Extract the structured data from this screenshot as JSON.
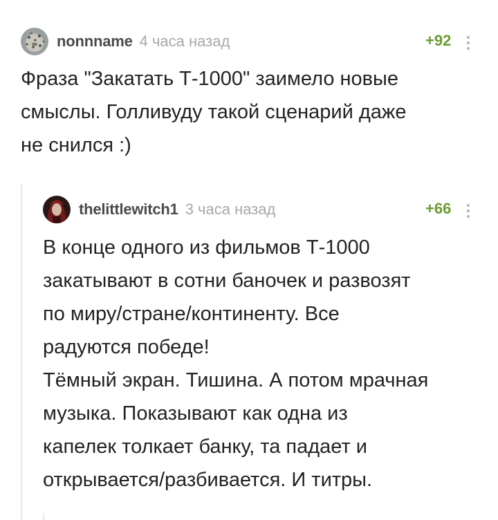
{
  "comments": [
    {
      "author": "nonnname",
      "time": "4 часа назад",
      "rating": "+92",
      "avatar_icon": "leopard-avatar",
      "lines": [
        "Фраза \"Закатать Т-1000\" заимело новые",
        "смыслы. Голливуду такой сценарий даже",
        "не снился :)"
      ]
    },
    {
      "author": "thelittlewitch1",
      "time": "3 часа назад",
      "rating": "+66",
      "avatar_icon": "witch-avatar",
      "lines": [
        "В конце одного из фильмов Т-1000",
        "закатывают в сотни баночек и развозят",
        "по миру/стране/континенту. Все",
        "радуются победе!",
        "Тёмный экран. Тишина. А потом мрачная",
        "музыка. Показывают как одна из",
        "капелек толкает банку, та падает и",
        "открывается/разбивается. И титры."
      ]
    }
  ],
  "colors": {
    "rating": "#6b9c2f",
    "author": "#4a4a4a",
    "time": "#a8a8a8",
    "thread_line": "#e8e8e8"
  }
}
